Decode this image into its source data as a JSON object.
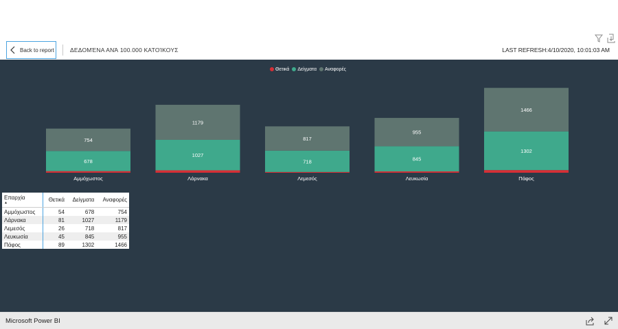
{
  "header": {
    "back_label": "Back to report",
    "page_title": "ΔΕΔΟΜΈΝΑ ΑΝΆ 100.000 ΚΑΤΟΊΚΟΥΣ",
    "last_refresh": "LAST REFRESH:4/10/2020, 10:01:03 AM",
    "icons": [
      "filter-icon",
      "export-icon",
      "chevron-left-icon"
    ]
  },
  "legend": [
    {
      "label": "Θετικά",
      "color": "#d62f36"
    },
    {
      "label": "Δείγματα",
      "color": "#3fa98c"
    },
    {
      "label": "Αναφορές",
      "color": "#5f7570"
    }
  ],
  "chart_data": {
    "type": "bar",
    "stacked": true,
    "categories": [
      "Αμμόχωστος",
      "Λάρνακα",
      "Λεμεσός",
      "Λευκωσία",
      "Πάφος"
    ],
    "series": [
      {
        "name": "Θετικά",
        "values": [
          54,
          81,
          26,
          45,
          89
        ],
        "color": "#d62f36"
      },
      {
        "name": "Δείγματα",
        "values": [
          678,
          1027,
          718,
          845,
          1302
        ],
        "color": "#3fa98c"
      },
      {
        "name": "Αναφορές",
        "values": [
          754,
          1179,
          817,
          955,
          1466
        ],
        "color": "#5f7570"
      }
    ],
    "data_labels": {
      "Δείγματα": [
        "678",
        "1027",
        "718",
        "845",
        "1302"
      ],
      "Αναφορές": [
        "754",
        "1179",
        "817",
        "955",
        "1466"
      ]
    },
    "title": "",
    "xlabel": "",
    "ylabel": "",
    "grid": false,
    "legend_position": "top-center"
  },
  "table": {
    "columns": [
      "Επαρχία",
      "Θετικά",
      "Δείγματα",
      "Αναφορές"
    ],
    "rows": [
      [
        "Αμμόχωστος",
        "54",
        "678",
        "754"
      ],
      [
        "Λάρνακα",
        "81",
        "1027",
        "1179"
      ],
      [
        "Λεμεσός",
        "26",
        "718",
        "817"
      ],
      [
        "Λευκωσία",
        "45",
        "845",
        "955"
      ],
      [
        "Πάφος",
        "89",
        "1302",
        "1466"
      ]
    ],
    "sort_indicator": "▲"
  },
  "footer": {
    "label": "Microsoft Power BI",
    "icons": [
      "share-icon",
      "expand-icon"
    ]
  }
}
